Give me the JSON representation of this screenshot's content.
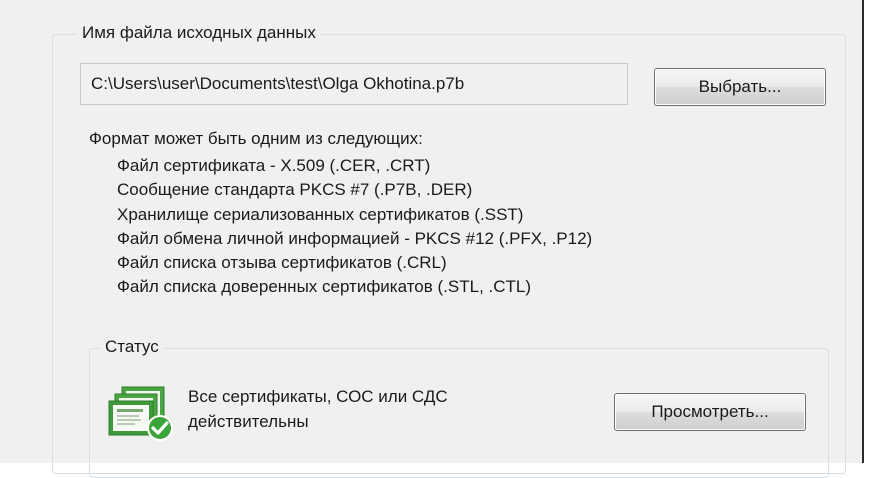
{
  "source_group": {
    "title": "Имя файла исходных данных",
    "file_path": "C:\\Users\\user\\Documents\\test\\Olga Okhotina.p7b",
    "browse_label": "Выбрать..."
  },
  "formats": {
    "heading": "Формат может быть одним из следующих:",
    "items": [
      "Файл сертификата - X.509 (.CER, .CRT)",
      "Сообщение стандарта PKCS #7 (.P7B, .DER)",
      "Хранилище сериализованных сертификатов (.SST)",
      "Файл обмена личной информацией - PKCS #12 (.PFX, .P12)",
      "Файл списка отзыва сертификатов (.CRL)",
      "Файл списка доверенных сертификатов (.STL, .CTL)"
    ]
  },
  "status_group": {
    "title": "Статус",
    "icon": "certificates-valid-icon",
    "message_line1": "Все сертификаты, СОС или СДС",
    "message_line2": "действительны",
    "view_label": "Просмотреть..."
  },
  "colors": {
    "window_bg": "#f0f0f0",
    "groupbox_border": "#d5dfe5",
    "certificate_green": "#3f9a3a",
    "check_green": "#3aa63a"
  }
}
